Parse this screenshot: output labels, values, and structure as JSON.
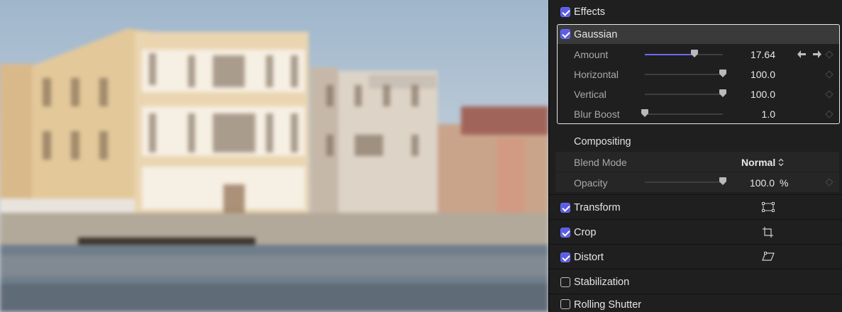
{
  "inspector": {
    "effects": {
      "label": "Effects",
      "checked": true
    },
    "gaussian": {
      "label": "Gaussian",
      "checked": true,
      "params": [
        {
          "label": "Amount",
          "value": "17.64",
          "fraction": 0.64
        },
        {
          "label": "Horizontal",
          "value": "100.0",
          "fraction": 1.0
        },
        {
          "label": "Vertical",
          "value": "100.0",
          "fraction": 1.0
        },
        {
          "label": "Blur Boost",
          "value": "1.0",
          "fraction": 0.0
        }
      ]
    },
    "compositing": {
      "label": "Compositing",
      "blend_mode": {
        "label": "Blend Mode",
        "value": "Normal"
      },
      "opacity": {
        "label": "Opacity",
        "value": "100.0",
        "unit": "%",
        "fraction": 1.0
      }
    },
    "sections": [
      {
        "label": "Transform",
        "checked": true,
        "icon": "transform-icon"
      },
      {
        "label": "Crop",
        "checked": true,
        "icon": "crop-icon"
      },
      {
        "label": "Distort",
        "checked": true,
        "icon": "distort-icon"
      },
      {
        "label": "Stabilization",
        "checked": false
      },
      {
        "label": "Rolling Shutter",
        "checked": false
      }
    ]
  },
  "colors": {
    "accent": "#5c5ce8",
    "panel": "#1f1f1f",
    "highlight_border": "#e8e8e8"
  }
}
